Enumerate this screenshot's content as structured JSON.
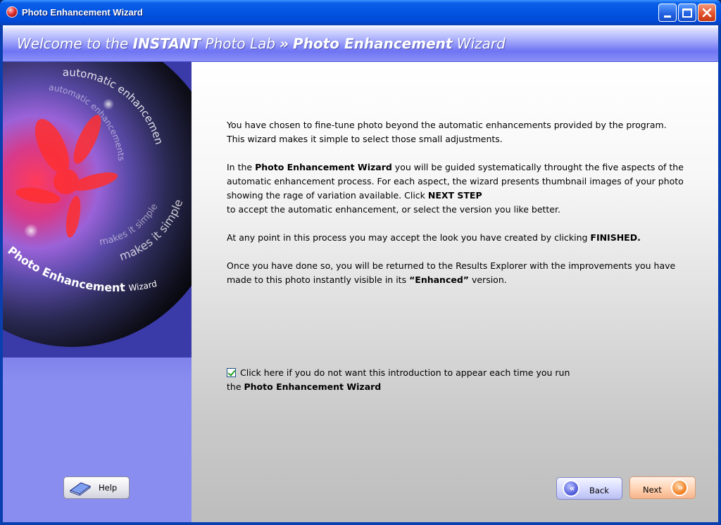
{
  "window": {
    "title": "Photo Enhancement Wizard"
  },
  "banner": {
    "part1": "Welcome to the ",
    "part2": "INSTANT",
    "part3": " Photo Lab",
    "part4": "Photo Enhancement",
    "part5": " Wizard"
  },
  "art": {
    "line1": "automatic enhancements",
    "line2": "automatic enhancements",
    "line3": "makes it simple",
    "line4": "makes it simple",
    "brand_bold": "Photo Enhancement",
    "brand_light": "Wizard"
  },
  "content": {
    "p1": "You have chosen to fine-tune photo beyond the automatic enhancements provided by the program. This wizard makes it simple to select those small adjustments.",
    "p2_a": "In the ",
    "p2_b": "Photo Enhancement Wizard",
    "p2_c": " you will be guided systematically throught the five aspects of the automatic enhancement process. For each aspect, the wizard presents thumbnail images of your photo showing the rage of variation available. Click ",
    "p2_d": "NEXT STEP",
    "p2_e": "to accept the automatic enhancement, or select the version you like better.",
    "p3_a": "At any point in this process you may accept the look you have created by clicking ",
    "p3_b": "FINISHED.",
    "p4_a": "Once you have done so, you will be returned to the Results Explorer with the improvements you have made to this photo instantly visible in its ",
    "p4_b": "“Enhanced”",
    "p4_c": " version.",
    "checkbox_label_a": "Click here if you do not want this introduction to appear each time you run",
    "checkbox_label_b": "the ",
    "checkbox_label_c": "Photo Enhancement Wizard"
  },
  "buttons": {
    "help": "Help",
    "back": "Back",
    "next": "Next"
  }
}
